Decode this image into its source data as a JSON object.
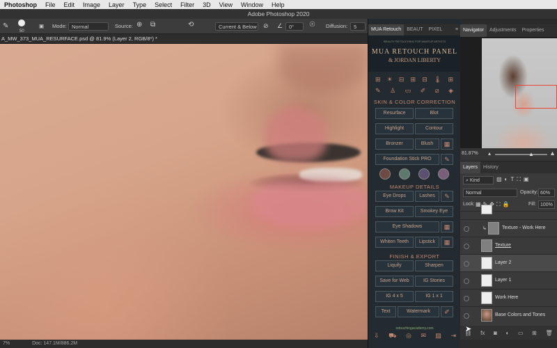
{
  "menubar": {
    "app_name": "Photoshop",
    "items": [
      "File",
      "Edit",
      "Image",
      "Layer",
      "Type",
      "Select",
      "Filter",
      "3D",
      "View",
      "Window",
      "Help"
    ]
  },
  "window": {
    "title": "Adobe Photoshop 2020"
  },
  "options": {
    "brush_size": "50",
    "mode_label": "Mode:",
    "mode_value": "Normal",
    "source_label": "Source:",
    "sample_value": "Current & Below",
    "angle_value": "0°",
    "diffusion_label": "Diffusion:",
    "diffusion_value": "5"
  },
  "document": {
    "tab_title": "A_MW_373_MUA_RESURFACE.psd @ 81.9% (Layer 2, RGB/8*) *"
  },
  "status": {
    "zoom": "7%",
    "doc_size": "Doc: 147.1M/886.2M"
  },
  "mua_panel": {
    "tabs": [
      "MUA Retouch",
      "BEAUT",
      "PIXEL"
    ],
    "title": "MUA RETOUCH PANEL",
    "subtitle": "& JORDAN LIBERTY",
    "tiny_text": "BEAUTY RETOUCHING FOR MAKEUP ARTISTS",
    "sections": {
      "skin": "SKIN & COLOR CORRECTION",
      "makeup": "MAKEUP DETAILS",
      "finish": "FINISH & EXPORT"
    },
    "buttons": {
      "resurface": "Resurface",
      "blot": "Blot",
      "highlight": "Highlight",
      "contour": "Contour",
      "bronzer": "Bronzer",
      "blush": "Blush",
      "foundation": "Foundation Stick PRO",
      "eye_drops": "Eye Drops",
      "lashes": "Lashes",
      "brow_kit": "Brow Kit",
      "smokey_eye": "Smokey Eye",
      "eye_shadows": "Eye Shadows",
      "whiten_teeth": "Whiten Teeth",
      "lipstick": "Lipstick",
      "liquify": "Liquify",
      "sharpen": "Sharpen",
      "save_for_web": "Save for Web",
      "ig_stories": "IG Stories",
      "ig_4x5": "IG 4 x 5",
      "ig_1x1": "IG 1 x 1",
      "text": "Text",
      "watermark": "Watermark"
    },
    "swatch_colors": [
      "#6e4a44",
      "#5e7a6e",
      "#5a5070",
      "#7a5e7a"
    ],
    "footer": "retouchingacademy.com"
  },
  "right_panel": {
    "tabs": [
      "Navigator",
      "Adjustments",
      "Properties"
    ],
    "zoom": "81.87%"
  },
  "layers_panel": {
    "tabs": [
      "Layers",
      "History"
    ],
    "kind_label": "Kind",
    "blend_mode": "Normal",
    "opacity_label": "Opacity:",
    "opacity_value": "60%",
    "lock_label": "Lock:",
    "fill_label": "Fill:",
    "fill_value": "100%",
    "layers": [
      {
        "name": "Texture - Work Here",
        "thumb": "grey"
      },
      {
        "name": "Texture",
        "thumb": "grey"
      },
      {
        "name": "Layer 2",
        "thumb": "white"
      },
      {
        "name": "Layer 1",
        "thumb": "white"
      },
      {
        "name": "Work Here",
        "thumb": "white"
      },
      {
        "name": "Base Colors and Tones",
        "thumb": "photo"
      }
    ]
  }
}
